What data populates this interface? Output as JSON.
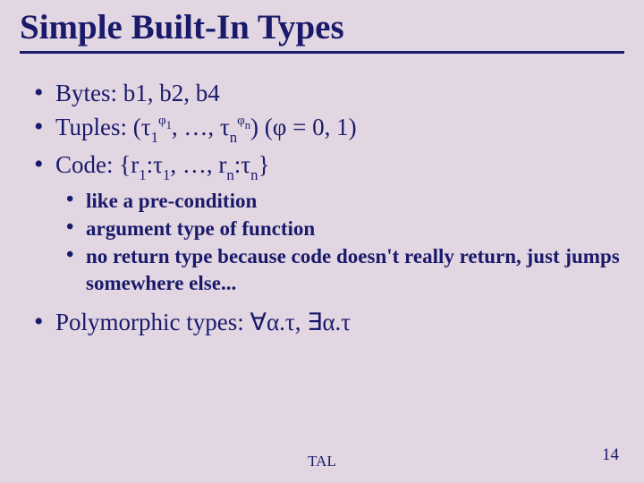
{
  "title": "Simple Built-In Types",
  "bullets": {
    "b0": "Bytes:  b1, b2, b4",
    "b1_prefix": "Tuples:  (",
    "b1_mid": ", …, ",
    "b1_close": ")  ",
    "phi_eq": "(φ = 0, 1)",
    "b2_prefix": "Code: {r",
    "b2_c1": ":",
    "b2_mid": ", …, r",
    "b2_c2": ":",
    "b2_close": "}",
    "b3_prefix": "Polymorphic types: ",
    "b3_mid": ", "
  },
  "sym": {
    "tau": "τ",
    "phi": "φ",
    "alpha": "α",
    "forall": "∀",
    "exists": "∃",
    "dot": "."
  },
  "idx": {
    "one": "1",
    "n": "n"
  },
  "sub": {
    "s0": "like a pre-condition",
    "s1": "argument type of function",
    "s2": "no return type because code doesn't really return, just jumps somewhere else..."
  },
  "footer": {
    "center": "TAL",
    "page": "14"
  }
}
